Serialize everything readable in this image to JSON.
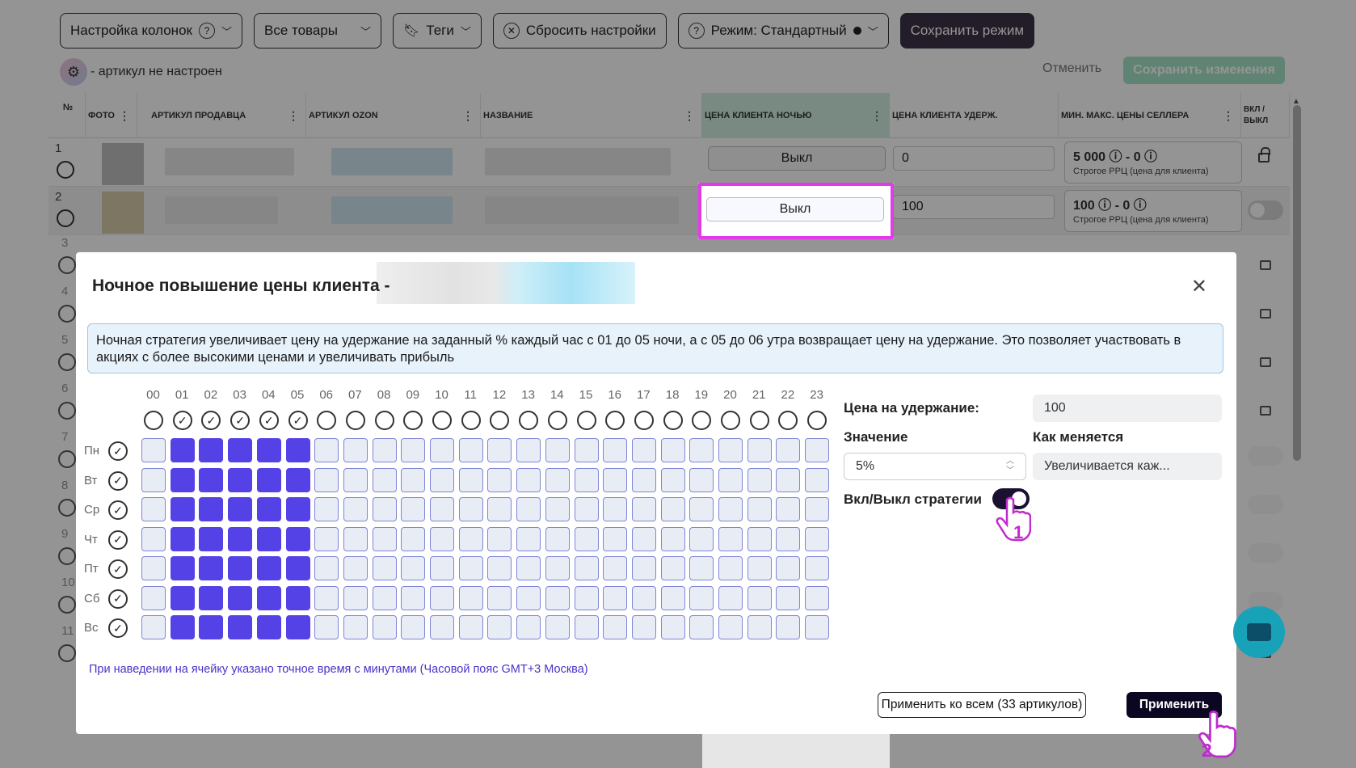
{
  "toolbar": {
    "columns_label": "Настройка колонок",
    "all_goods_label": "Все товары",
    "tags_label": "Теги",
    "reset_label": "Сбросить настройки",
    "mode_label": "Режим: Стандартный",
    "save_mode_label": "Сохранить режим"
  },
  "legend": {
    "text": "- артикул не настроен"
  },
  "actions": {
    "cancel_label": "Отменить",
    "save_changes_label": "Сохранить изменения"
  },
  "table": {
    "headers": {
      "num": "№",
      "photo": "ФОТО",
      "seller_sku": "АРТИКУЛ ПРОДАВЦА",
      "ozon_sku": "АРТИКУЛ OZON",
      "name": "НАЗВАНИЕ",
      "night_price": "ЦЕНА КЛИЕНТА НОЧЬЮ",
      "hold_price": "ЦЕНА КЛИЕНТА УДЕРЖ.",
      "min_max": "МИН. МАКС. ЦЕНЫ СЕЛЛЕРА",
      "on_off": "ВКЛ / ВЫКЛ"
    },
    "rows": [
      {
        "num": "1",
        "night": "Выкл",
        "hold": "0",
        "minmax": "5 000 ⓘ - 0 ⓘ",
        "minmax_sub": "Строгое РРЦ (цена для клиента)"
      },
      {
        "num": "2",
        "night": "Выкл",
        "hold": "100",
        "minmax": "100 ⓘ - 0 ⓘ",
        "minmax_sub": "Строгое РРЦ (цена для клиента)"
      }
    ],
    "row_numbers_below": [
      "3",
      "4",
      "5",
      "6",
      "7",
      "8",
      "9",
      "10",
      "11"
    ]
  },
  "modal": {
    "title": "Ночное повышение цены клиента -",
    "info": "Ночная стратегия увеличивает цену на удержание на заданный % каждый час с 01 до 05 ночи, а с 05 до 06 утра возвращает цену на удержание. Это позволяет участвовать в акциях с более высокими ценами и увеличивать прибыль",
    "hours": [
      "00",
      "01",
      "02",
      "03",
      "04",
      "05",
      "06",
      "07",
      "08",
      "09",
      "10",
      "11",
      "12",
      "13",
      "14",
      "15",
      "16",
      "17",
      "18",
      "19",
      "20",
      "21",
      "22",
      "23"
    ],
    "hours_checked": [
      1,
      2,
      3,
      4,
      5
    ],
    "days": [
      "Пн",
      "Вт",
      "Ср",
      "Чт",
      "Пт",
      "Сб",
      "Вс"
    ],
    "note": "При наведении на ячейку указано точное время с минутами (Часовой пояс GMT+3 Москва)",
    "hold_price_label": "Цена на удержание:",
    "hold_price_value": "100",
    "value_label": "Значение",
    "value": "5%",
    "change_label": "Как меняется",
    "change_value": "Увеличивается каж...",
    "strategy_label": "Вкл/Выкл стратегии",
    "apply_all_label": "Применить ко всем (33 артикулов)",
    "apply_label": "Применить",
    "step1": "1",
    "step2": "2"
  },
  "colors": {
    "accent_cell": "#5442e6",
    "highlight_frame": "#e23ce8",
    "apply_bg": "#0b0722",
    "chat_fab": "#17a2b8"
  },
  "icons": [
    "help-circle-icon",
    "chevron-down-icon",
    "bookmark-icon",
    "reset-icon",
    "gear-icon",
    "kebab-icon",
    "lock-icon",
    "close-icon",
    "check-icon",
    "pointer-hand-icon",
    "chat-icon"
  ]
}
